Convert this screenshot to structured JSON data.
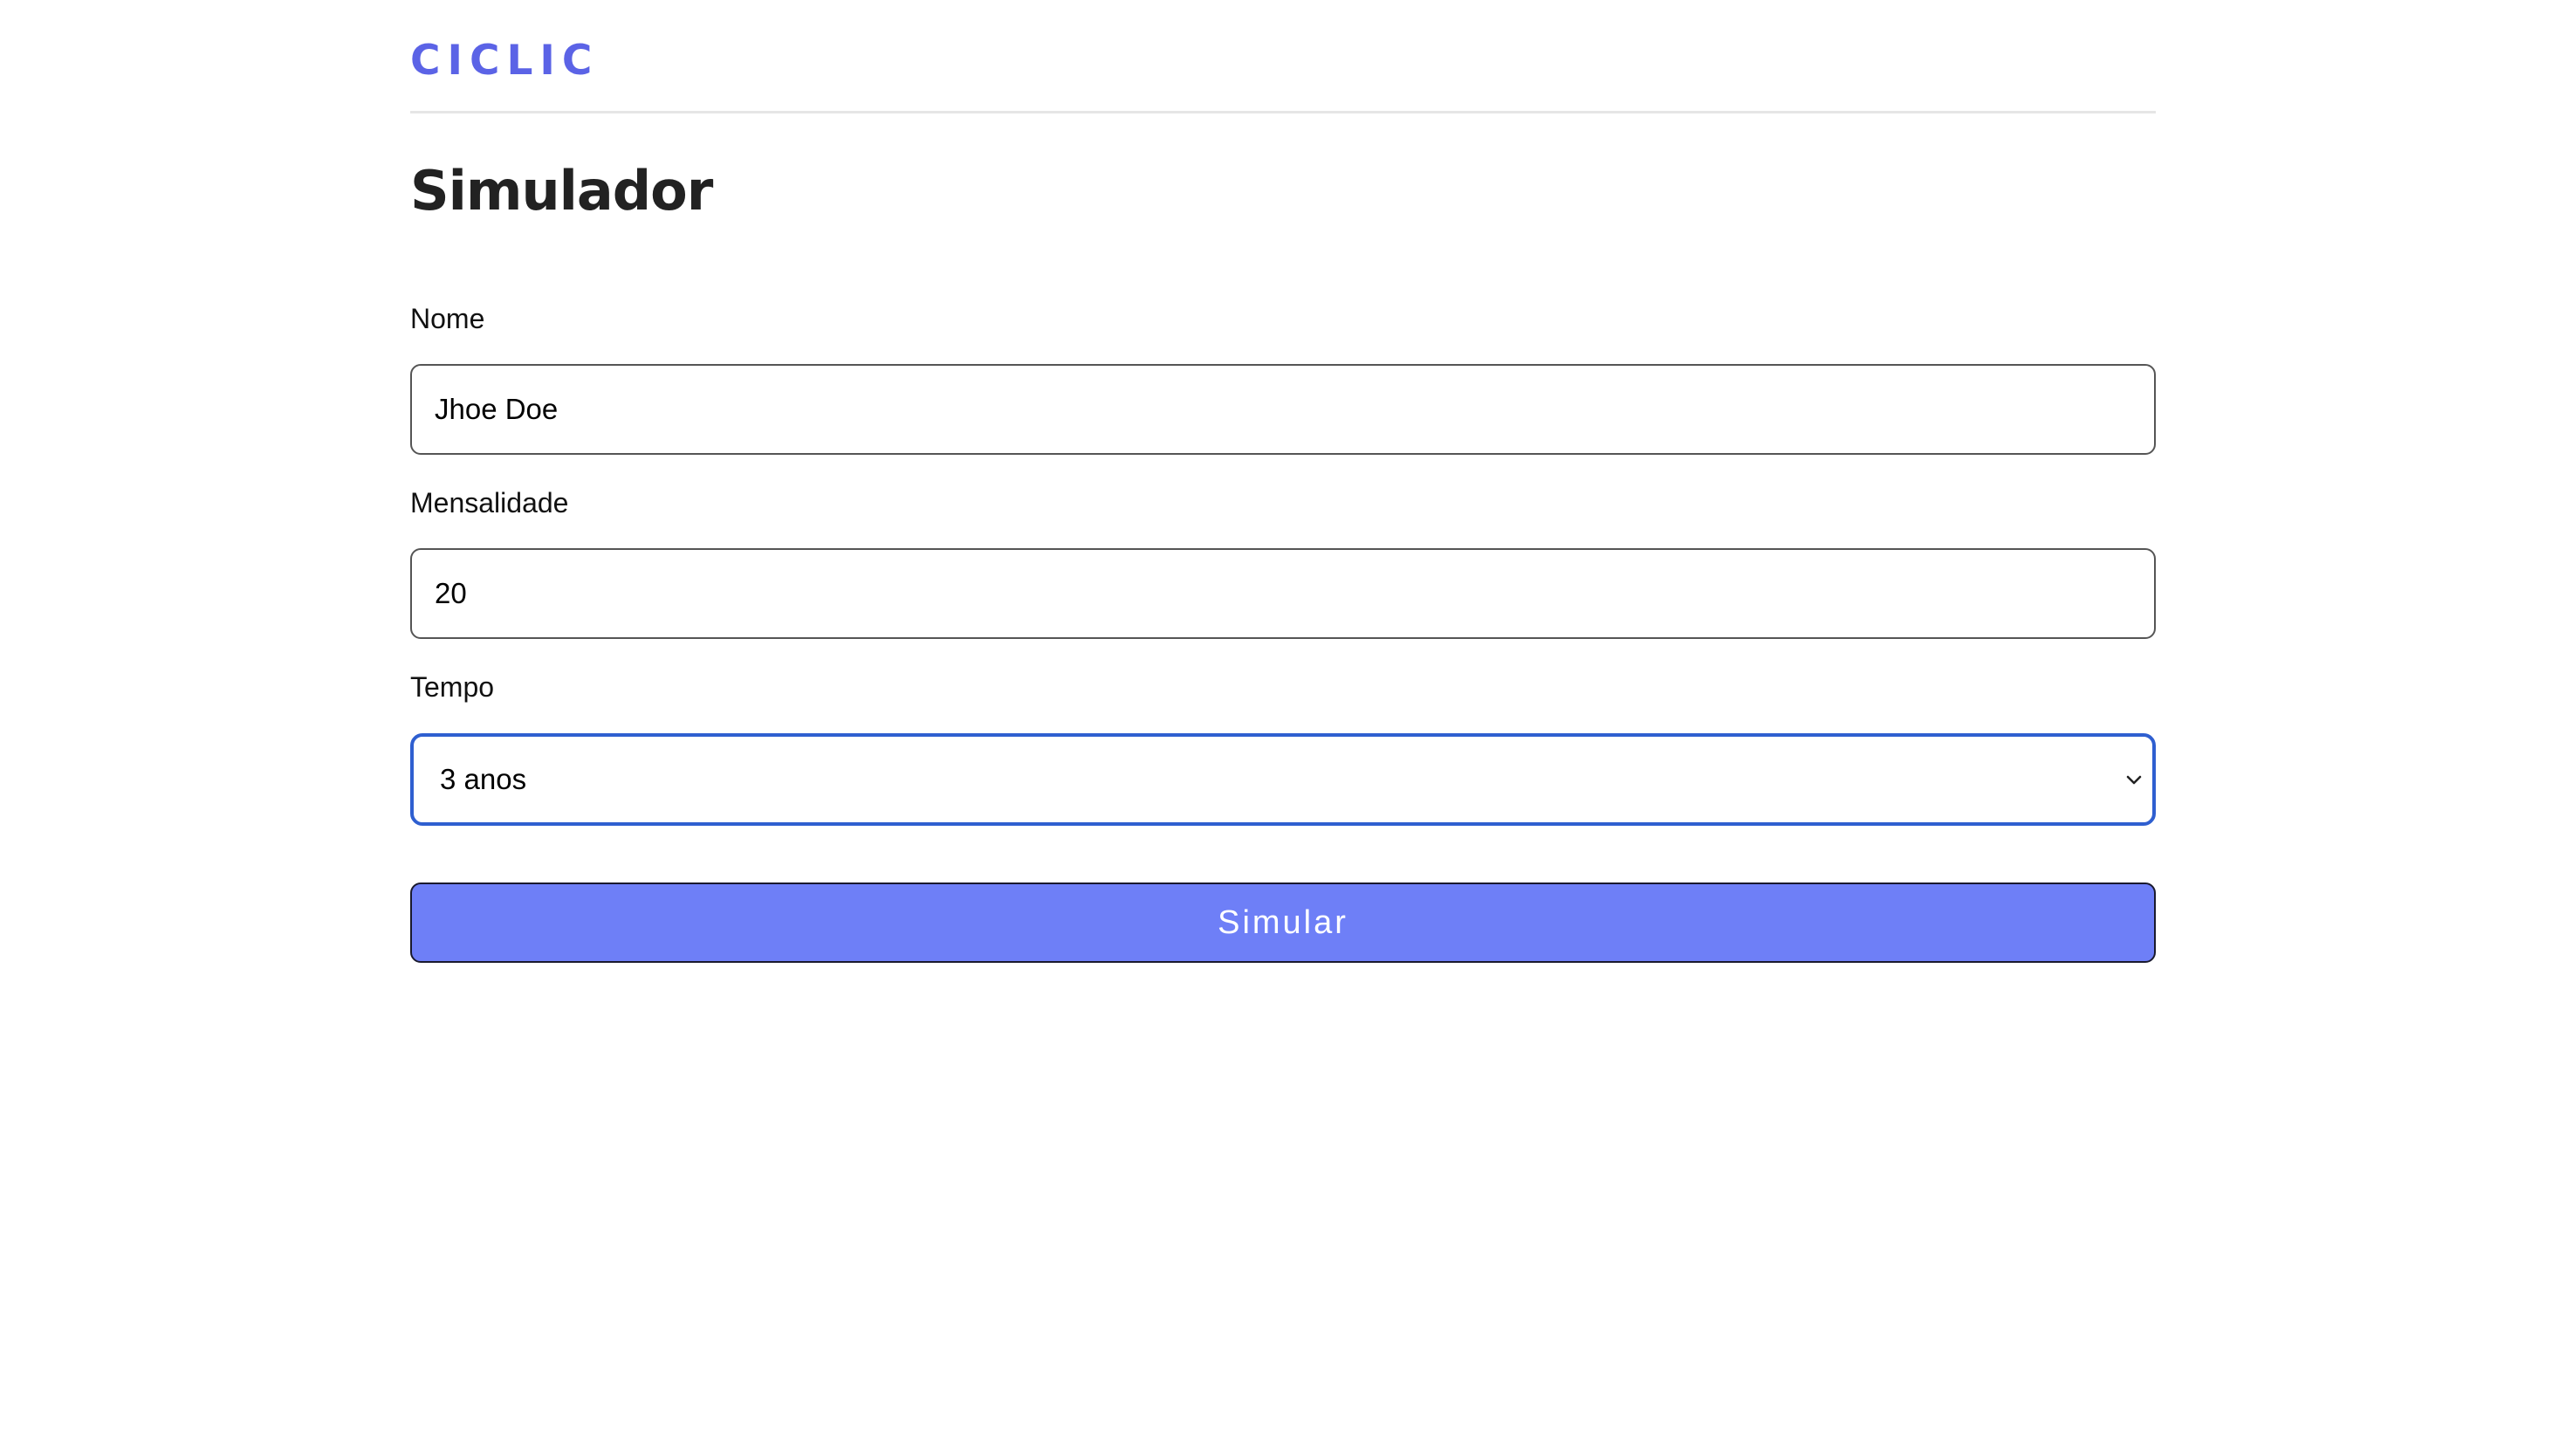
{
  "header": {
    "logo_text": "CICLIC"
  },
  "page": {
    "title": "Simulador"
  },
  "form": {
    "nome": {
      "label": "Nome",
      "value": "Jhoe Doe"
    },
    "mensalidade": {
      "label": "Mensalidade",
      "value": "20"
    },
    "tempo": {
      "label": "Tempo",
      "selected": "3 anos"
    },
    "submit_label": "Simular"
  },
  "colors": {
    "brand": "#5b63e6",
    "button": "#6e7ff7",
    "focus_border": "#2f5fd0"
  },
  "icons": {
    "select_chevron": "chevron-down-icon"
  }
}
